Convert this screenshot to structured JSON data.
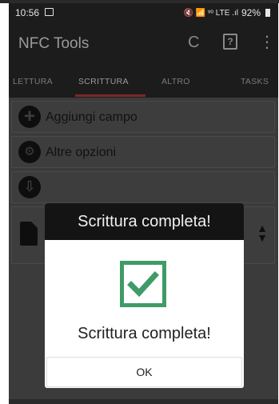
{
  "status_bar": {
    "time": "10:56",
    "indicators": "🔇 📶 ᵛᵒ LTE .ıl",
    "battery": "92%"
  },
  "app_bar": {
    "title": "NFC Tools",
    "icons": [
      "nfc-icon",
      "help-icon",
      "more-vert-icon"
    ],
    "help_glyph": "?",
    "nfc_glyph": "C",
    "more_glyph": "⋮"
  },
  "tabs": [
    {
      "label": "LETTURA",
      "active": false
    },
    {
      "label": "SCRITTURA",
      "active": true
    },
    {
      "label": "ALTRO",
      "active": false
    },
    {
      "label": "TASKS",
      "active": false
    }
  ],
  "list": {
    "items": [
      {
        "label": "Aggiungi campo",
        "icon": "add-circle-icon",
        "glyph": "+"
      },
      {
        "label": "Altre opzioni",
        "icon": "wrench-circle-icon",
        "glyph": "🔧"
      },
      {
        "label": "",
        "icon": "download-circle-icon",
        "glyph": "⇩"
      }
    ]
  },
  "dialog": {
    "title": "Scrittura completa!",
    "message": "Scrittura completa!",
    "button_label": "OK",
    "check_color": "#3f9b67"
  },
  "colors": {
    "tab_indicator": "#7a2a28",
    "dim_bg": "#3b3b3b",
    "check": "#3f9b67"
  }
}
